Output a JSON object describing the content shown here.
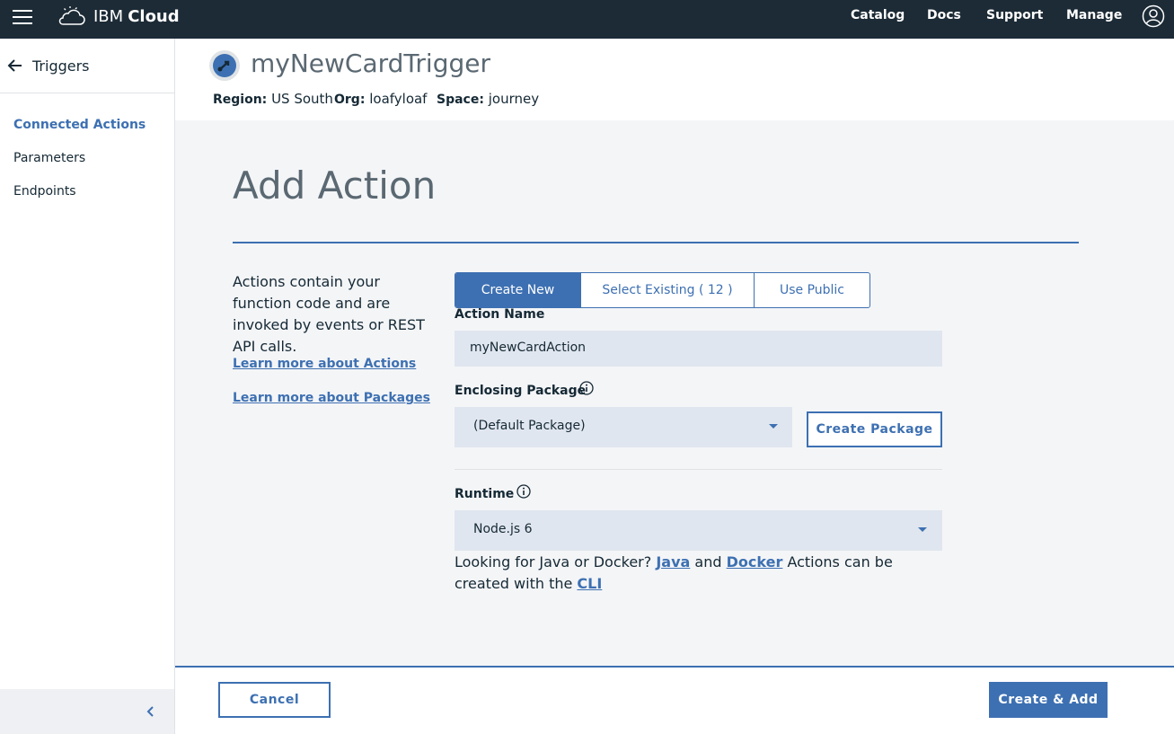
{
  "topbar": {
    "brand_ibm": "IBM",
    "brand_cloud": "Cloud",
    "nav": [
      "Catalog",
      "Docs",
      "Support",
      "Manage"
    ]
  },
  "sidebar": {
    "back_label": "Triggers",
    "items": [
      {
        "label": "Connected Actions",
        "active": true
      },
      {
        "label": "Parameters",
        "active": false
      },
      {
        "label": "Endpoints",
        "active": false
      }
    ]
  },
  "header": {
    "title": "myNewCardTrigger",
    "region_label": "Region:",
    "region_value": "US South",
    "org_label": "Org:",
    "org_value": "loafyloaf",
    "space_label": "Space:",
    "space_value": "journey"
  },
  "main": {
    "title": "Add Action",
    "description": "Actions contain your function code and are invoked by events or REST API calls.",
    "learn_actions": "Learn more about Actions",
    "learn_packages": "Learn more about Packages",
    "tabs": [
      {
        "label": "Create New",
        "selected": true
      },
      {
        "label": "Select Existing ( 12 )",
        "selected": false
      },
      {
        "label": "Use Public",
        "selected": false
      }
    ],
    "action_name_label": "Action Name",
    "action_name_value": "myNewCardAction",
    "package_label": "Enclosing Package",
    "package_value": "(Default Package)",
    "create_package_label": "Create Package",
    "runtime_label": "Runtime",
    "runtime_value": "Node.js 6",
    "hint_prefix": "Looking for Java or Docker?",
    "hint_java": "Java",
    "hint_and": "and",
    "hint_docker": "Docker",
    "hint_middle": "Actions can be created with the",
    "hint_cli": "CLI"
  },
  "footer": {
    "cancel_label": "Cancel",
    "create_label": "Create & Add"
  },
  "colors": {
    "topbar": "#1c2b36",
    "accent": "#3d70b2",
    "field_bg": "#e0e6ef",
    "page_bg": "#f4f5f7"
  }
}
